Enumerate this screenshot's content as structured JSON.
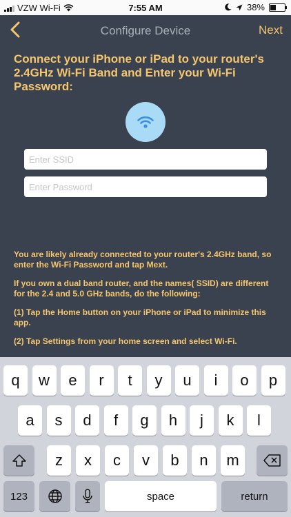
{
  "status_bar": {
    "carrier": "VZW Wi-Fi",
    "time": "7:55 AM",
    "battery": "38%",
    "battery_level": 0.38
  },
  "nav": {
    "title": "Configure Device",
    "next_label": "Next"
  },
  "headline": "Connect your iPhone or iPad to your router's 2.4GHz Wi-Fi Band and Enter your Wi-Fi Password:",
  "ssid": {
    "placeholder": "Enter SSID",
    "value": ""
  },
  "password": {
    "placeholder": "Enter Password",
    "value": ""
  },
  "info": [
    "You are likely already connected to your router's 2.4GHz band, so enter the Wi-Fi Password and tap Mext.",
    "If you own a dual band router, and the names( SSID) are different for the 2.4 and 5.0 GHz bands, do the following:",
    "(1) Tap the Home button on your iPhone or iPad to minimize this app.",
    "(2) Tap Settings from your home screen and select Wi-Fi."
  ],
  "keyboard": {
    "row1": [
      "q",
      "w",
      "e",
      "r",
      "t",
      "y",
      "u",
      "i",
      "o",
      "p"
    ],
    "row2": [
      "a",
      "s",
      "d",
      "f",
      "g",
      "h",
      "j",
      "k",
      "l"
    ],
    "row3": [
      "z",
      "x",
      "c",
      "v",
      "b",
      "n",
      "m"
    ],
    "numbers_label": "123",
    "space_label": "space",
    "return_label": "return",
    "icons": {
      "shift": "shift-icon",
      "delete": "delete-icon",
      "globe": "globe-icon",
      "mic": "microphone-icon"
    }
  }
}
